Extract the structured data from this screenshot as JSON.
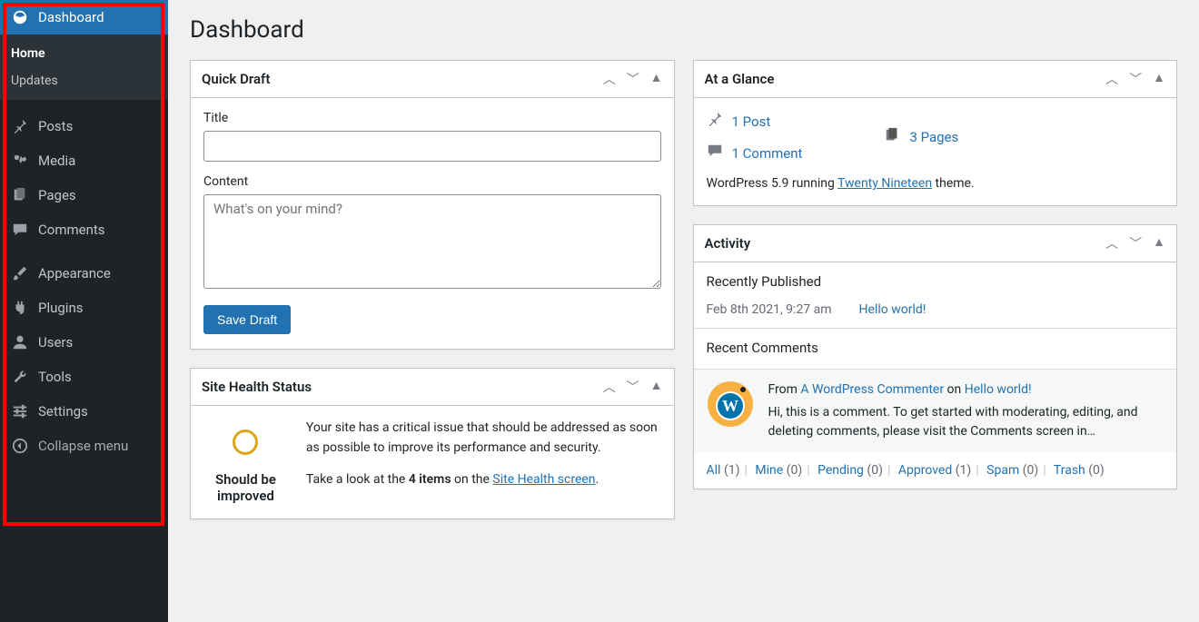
{
  "page": {
    "title": "Dashboard"
  },
  "sidebar": {
    "dashboard": "Dashboard",
    "sub": {
      "home": "Home",
      "updates": "Updates"
    },
    "posts": "Posts",
    "media": "Media",
    "pages": "Pages",
    "comments": "Comments",
    "appearance": "Appearance",
    "plugins": "Plugins",
    "users": "Users",
    "tools": "Tools",
    "settings": "Settings",
    "collapse": "Collapse menu"
  },
  "quickdraft": {
    "heading": "Quick Draft",
    "title_label": "Title",
    "content_label": "Content",
    "content_placeholder": "What's on your mind?",
    "save": "Save Draft"
  },
  "glance": {
    "heading": "At a Glance",
    "post": "1 Post",
    "pages": "3 Pages",
    "comment": "1 Comment",
    "running_prefix": "WordPress 5.9 running ",
    "theme": "Twenty Nineteen",
    "running_suffix": " theme."
  },
  "activity": {
    "heading": "Activity",
    "recently_published": "Recently Published",
    "pub_date": "Feb 8th 2021, 9:27 am",
    "pub_title": "Hello world!",
    "recent_comments": "Recent Comments",
    "from": "From ",
    "commenter": "A WordPress Commenter",
    "on": " on ",
    "comment_post": "Hello world!",
    "comment_text": "Hi, this is a comment. To get started with moderating, editing, and deleting comments, please visit the Comments screen in…",
    "filters": {
      "all": "All",
      "all_n": "(1)",
      "mine": "Mine",
      "mine_n": "(0)",
      "pending": "Pending",
      "pending_n": "(0)",
      "approved": "Approved",
      "approved_n": "(1)",
      "spam": "Spam",
      "spam_n": "(0)",
      "trash": "Trash",
      "trash_n": "(0)"
    }
  },
  "health": {
    "heading": "Site Health Status",
    "status": "Should be improved",
    "msg": "Your site has a critical issue that should be addressed as soon as possible to improve its performance and security.",
    "look_pre": "Take a look at the ",
    "items": "4 items",
    "look_mid": " on the ",
    "link": "Site Health screen",
    "dot": "."
  }
}
